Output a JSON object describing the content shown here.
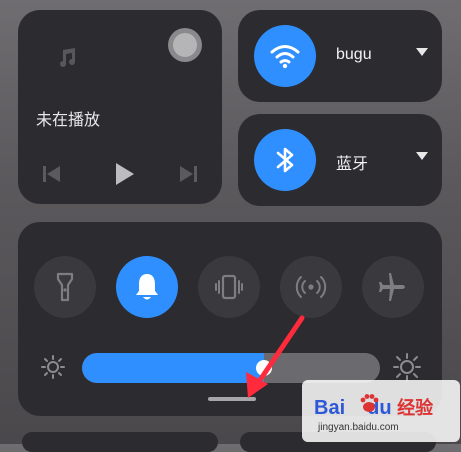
{
  "media": {
    "status": "未在播放",
    "icons": {
      "note": "music-note-icon",
      "prev": "previous-track-icon",
      "play": "play-icon",
      "next": "next-track-icon",
      "cast": "cast-device-icon"
    }
  },
  "wifi": {
    "label": "bugu",
    "icon": "wifi-icon",
    "color": "#2f8fff"
  },
  "bluetooth": {
    "label": "蓝牙",
    "icon": "bluetooth-icon",
    "color": "#2f8fff"
  },
  "toggles": [
    {
      "name": "flashlight",
      "active": false
    },
    {
      "name": "ringer",
      "active": true
    },
    {
      "name": "vibrate",
      "active": false
    },
    {
      "name": "hotspot",
      "active": false
    },
    {
      "name": "airplane-mode",
      "active": false
    }
  ],
  "brightness": {
    "level": 0.61
  },
  "watermark": {
    "logo": "Bai",
    "logo_suffix": "du",
    "brand_text": "经验",
    "site": "jingyan.baidu.com"
  },
  "colors": {
    "accent": "#2f8fff",
    "panel": "#2c2b2f",
    "arrow": "#ff2a3c"
  }
}
